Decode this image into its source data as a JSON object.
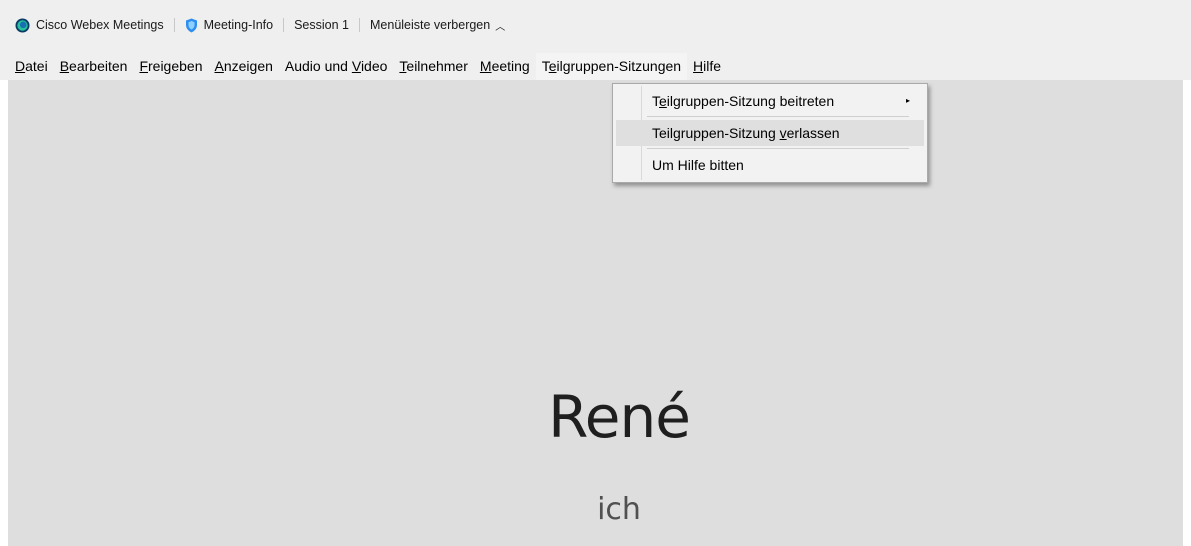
{
  "titlebar": {
    "app_name": "Cisco Webex Meetings",
    "meeting_info": "Meeting-Info",
    "session": "Session 1",
    "hide_menu": "Menüleiste verbergen"
  },
  "menubar": [
    {
      "pre": "",
      "mn": "D",
      "post": "atei"
    },
    {
      "pre": "",
      "mn": "B",
      "post": "earbeiten"
    },
    {
      "pre": "",
      "mn": "F",
      "post": "reigeben"
    },
    {
      "pre": "",
      "mn": "A",
      "post": "nzeigen"
    },
    {
      "pre": "Audio und ",
      "mn": "V",
      "post": "ideo"
    },
    {
      "pre": "",
      "mn": "T",
      "post": "eilnehmer"
    },
    {
      "pre": "",
      "mn": "M",
      "post": "eeting"
    },
    {
      "pre": "T",
      "mn": "e",
      "post": "ilgruppen-Sitzungen"
    },
    {
      "pre": "",
      "mn": "H",
      "post": "ilfe"
    }
  ],
  "dropdown": {
    "items": [
      {
        "pre": "T",
        "mn": "e",
        "post": "ilgruppen-Sitzung beitreten",
        "submenu_arrow": "▸"
      },
      {
        "pre": "Teilgruppen-Sitzung ",
        "mn": "v",
        "post": "erlassen"
      },
      {
        "pre": "Um Hilfe bitten",
        "mn": "",
        "post": ""
      }
    ]
  },
  "stage": {
    "name": "René",
    "subtitle": "ich"
  },
  "icons": {
    "logo": "webex-logo-icon",
    "shield": "shield-icon",
    "chevron": "chevron-up-icon"
  },
  "colors": {
    "menubar_bg": "#efefef",
    "stage_bg": "#dedede",
    "webex_blue": "#1a6fb4",
    "webex_green": "#27c29b",
    "shield_blue": "#2e8ff0"
  }
}
